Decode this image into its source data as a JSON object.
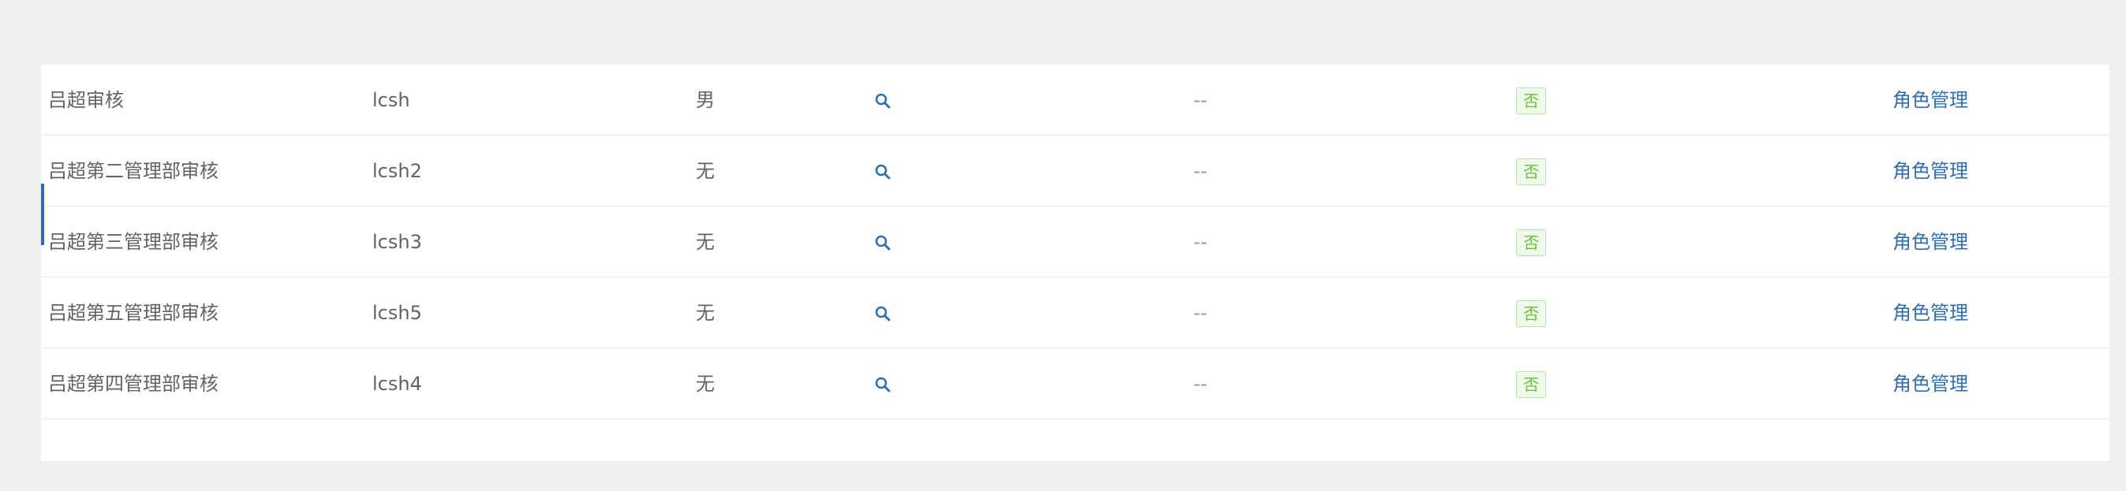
{
  "table": {
    "rows": [
      {
        "name": "吕超审核",
        "account": "lcsh",
        "gender": "男",
        "view_icon": "search-icon",
        "dash": "--",
        "status": "否",
        "action": "角色管理"
      },
      {
        "name": "吕超第二管理部审核",
        "account": "lcsh2",
        "gender": "无",
        "view_icon": "search-icon",
        "dash": "--",
        "status": "否",
        "action": "角色管理"
      },
      {
        "name": "吕超第三管理部审核",
        "account": "lcsh3",
        "gender": "无",
        "view_icon": "search-icon",
        "dash": "--",
        "status": "否",
        "action": "角色管理"
      },
      {
        "name": "吕超第五管理部审核",
        "account": "lcsh5",
        "gender": "无",
        "view_icon": "search-icon",
        "dash": "--",
        "status": "否",
        "action": "角色管理"
      },
      {
        "name": "吕超第四管理部审核",
        "account": "lcsh4",
        "gender": "无",
        "view_icon": "search-icon",
        "dash": "--",
        "status": "否",
        "action": "角色管理"
      }
    ]
  },
  "colors": {
    "link": "#2d6fb5",
    "badge_green": "#67c23a",
    "page_background": "#efefef"
  }
}
